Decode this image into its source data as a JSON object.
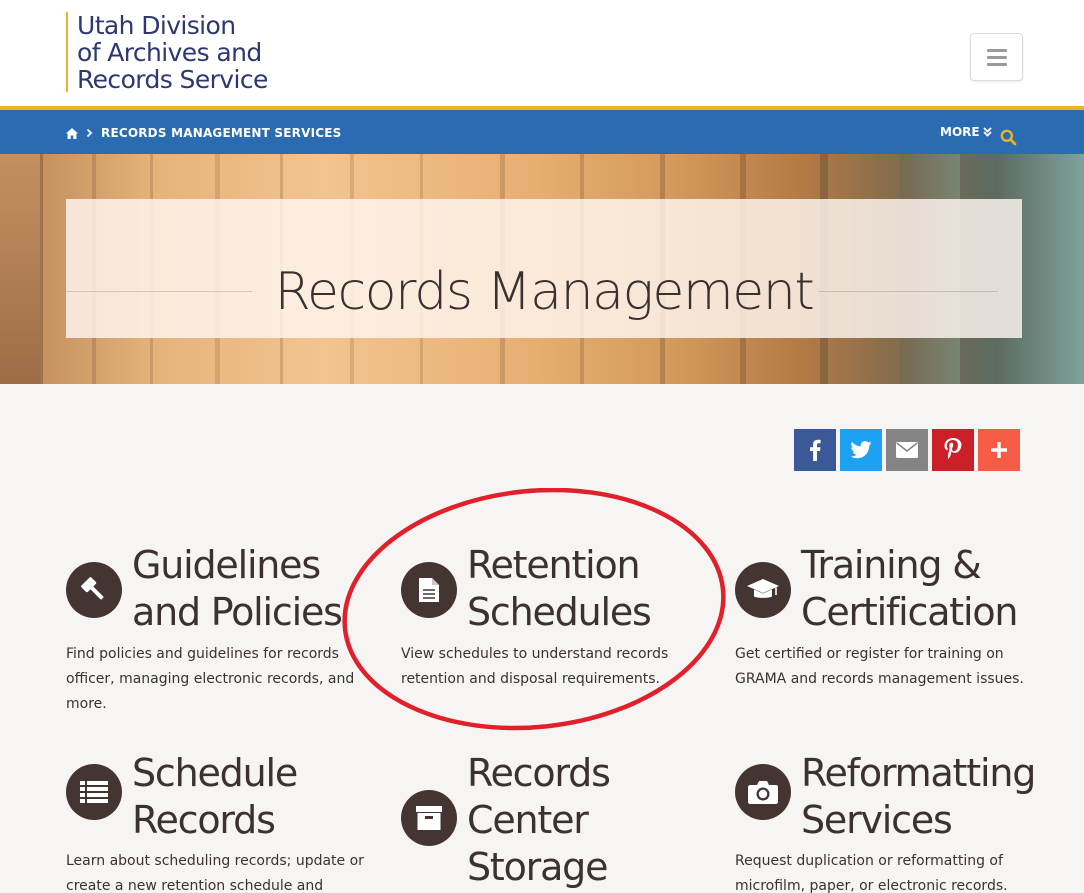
{
  "header": {
    "logo_lines": [
      "Utah Division",
      "of Archives and",
      "Records Service"
    ]
  },
  "nav": {
    "breadcrumb_current": "RECORDS MANAGEMENT SERVICES",
    "more_label": "MORE",
    "icons": [
      "home-icon",
      "chevron-right-icon",
      "double-chevron-down-icon",
      "search-icon",
      "hamburger-menu-icon"
    ]
  },
  "hero": {
    "title": "Records Management"
  },
  "share": {
    "buttons": [
      {
        "name": "facebook",
        "color": "#3b5998"
      },
      {
        "name": "twitter",
        "color": "#1da1f2"
      },
      {
        "name": "email",
        "color": "#848484"
      },
      {
        "name": "pinterest",
        "color": "#cb2027"
      },
      {
        "name": "more",
        "color": "#f65b45"
      }
    ]
  },
  "cards": [
    {
      "title_lines": [
        "Guidelines",
        "and Policies"
      ],
      "icon": "gavel-icon",
      "description": "Find policies and guidelines for records officer, managing electronic records, and more."
    },
    {
      "title_lines": [
        "Retention",
        "Schedules"
      ],
      "icon": "document-icon",
      "description": "View schedules to understand records retention and disposal requirements."
    },
    {
      "title_lines": [
        "Training &",
        "Certification"
      ],
      "icon": "graduation-cap-icon",
      "description": "Get certified or register for training on GRAMA and records management issues."
    },
    {
      "title_lines": [
        "Schedule",
        "Records"
      ],
      "icon": "list-icon",
      "description": "Learn about scheduling records; update or create a new retention schedule and"
    },
    {
      "title_lines": [
        "Records",
        "Center",
        "Storage"
      ],
      "icon": "archive-box-icon",
      "description": ""
    },
    {
      "title_lines": [
        "Reformatting",
        "Services"
      ],
      "icon": "camera-icon",
      "description": "Request duplication or reformatting of microfilm, paper, or electronic records."
    }
  ],
  "colors": {
    "brand_blue": "#2a6bb1",
    "brand_gold": "#e8b528",
    "logo_text": "#2f3770",
    "icon_circle": "#453532",
    "annotation_red": "#e0202a"
  }
}
